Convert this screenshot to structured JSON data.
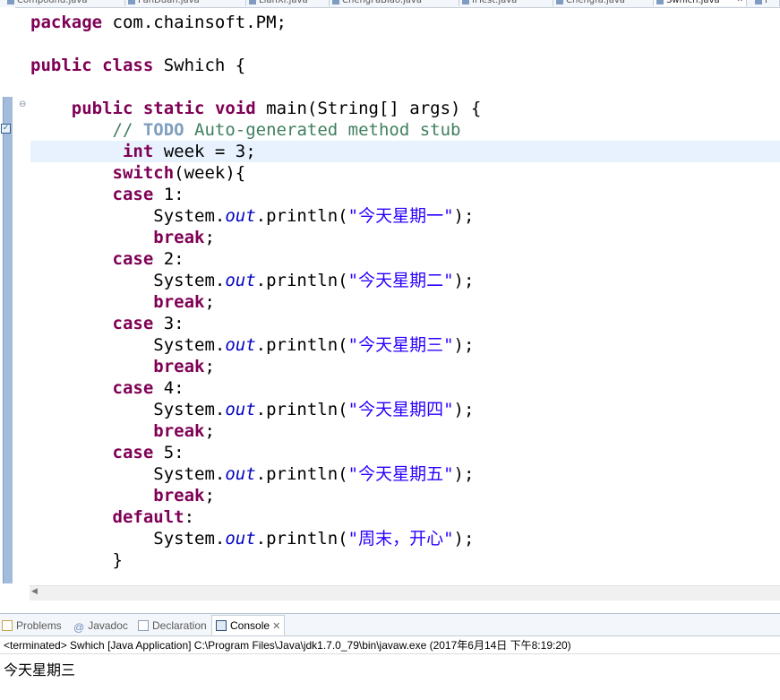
{
  "editor_tabs": [
    "Compound.java",
    "PanDuan.java",
    "LianXi.java",
    "ChengFaBiao.java",
    "IfTest.java",
    "Chengfa.java",
    "Swhich.java",
    "P"
  ],
  "active_tab_index": 6,
  "code": {
    "current_line_index": 6,
    "lines": [
      [
        {
          "t": "package",
          "c": "kw"
        },
        {
          "t": " com.chainsoft.PM;"
        }
      ],
      [],
      [
        {
          "t": "public",
          "c": "kw"
        },
        {
          "t": " "
        },
        {
          "t": "class",
          "c": "kw"
        },
        {
          "t": " Swhich {"
        }
      ],
      [],
      [
        {
          "t": "    "
        },
        {
          "t": "public",
          "c": "kw"
        },
        {
          "t": " "
        },
        {
          "t": "static",
          "c": "kw"
        },
        {
          "t": " "
        },
        {
          "t": "void",
          "c": "kw"
        },
        {
          "t": " main(String[] args) {"
        }
      ],
      [
        {
          "t": "        "
        },
        {
          "t": "// ",
          "c": "cm"
        },
        {
          "t": "TODO",
          "c": "todo"
        },
        {
          "t": " Auto-generated method stub",
          "c": "cm"
        }
      ],
      [
        {
          "t": "         "
        },
        {
          "t": "int",
          "c": "kw"
        },
        {
          "t": " week = 3;"
        }
      ],
      [
        {
          "t": "        "
        },
        {
          "t": "switch",
          "c": "kw"
        },
        {
          "t": "(week){"
        }
      ],
      [
        {
          "t": "        "
        },
        {
          "t": "case",
          "c": "kw"
        },
        {
          "t": " 1:"
        }
      ],
      [
        {
          "t": "            System."
        },
        {
          "t": "out",
          "c": "fld"
        },
        {
          "t": ".println("
        },
        {
          "t": "\"今天星期一\"",
          "c": "str"
        },
        {
          "t": ");"
        }
      ],
      [
        {
          "t": "            "
        },
        {
          "t": "break",
          "c": "kw"
        },
        {
          "t": ";"
        }
      ],
      [
        {
          "t": "        "
        },
        {
          "t": "case",
          "c": "kw"
        },
        {
          "t": " 2:"
        }
      ],
      [
        {
          "t": "            System."
        },
        {
          "t": "out",
          "c": "fld"
        },
        {
          "t": ".println("
        },
        {
          "t": "\"今天星期二\"",
          "c": "str"
        },
        {
          "t": ");"
        }
      ],
      [
        {
          "t": "            "
        },
        {
          "t": "break",
          "c": "kw"
        },
        {
          "t": ";"
        }
      ],
      [
        {
          "t": "        "
        },
        {
          "t": "case",
          "c": "kw"
        },
        {
          "t": " 3:"
        }
      ],
      [
        {
          "t": "            System."
        },
        {
          "t": "out",
          "c": "fld"
        },
        {
          "t": ".println("
        },
        {
          "t": "\"今天星期三\"",
          "c": "str"
        },
        {
          "t": ");"
        }
      ],
      [
        {
          "t": "            "
        },
        {
          "t": "break",
          "c": "kw"
        },
        {
          "t": ";"
        }
      ],
      [
        {
          "t": "        "
        },
        {
          "t": "case",
          "c": "kw"
        },
        {
          "t": " 4:"
        }
      ],
      [
        {
          "t": "            System."
        },
        {
          "t": "out",
          "c": "fld"
        },
        {
          "t": ".println("
        },
        {
          "t": "\"今天星期四\"",
          "c": "str"
        },
        {
          "t": ");"
        }
      ],
      [
        {
          "t": "            "
        },
        {
          "t": "break",
          "c": "kw"
        },
        {
          "t": ";"
        }
      ],
      [
        {
          "t": "        "
        },
        {
          "t": "case",
          "c": "kw"
        },
        {
          "t": " 5:"
        }
      ],
      [
        {
          "t": "            System."
        },
        {
          "t": "out",
          "c": "fld"
        },
        {
          "t": ".println("
        },
        {
          "t": "\"今天星期五\"",
          "c": "str"
        },
        {
          "t": ");"
        }
      ],
      [
        {
          "t": "            "
        },
        {
          "t": "break",
          "c": "kw"
        },
        {
          "t": ";"
        }
      ],
      [
        {
          "t": "        "
        },
        {
          "t": "default",
          "c": "kw"
        },
        {
          "t": ":"
        }
      ],
      [
        {
          "t": "            System."
        },
        {
          "t": "out",
          "c": "fld"
        },
        {
          "t": ".println("
        },
        {
          "t": "\"周末，开心\"",
          "c": "str"
        },
        {
          "t": ");"
        }
      ],
      [
        {
          "t": "        }"
        }
      ]
    ]
  },
  "bottom_panel": {
    "tabs": [
      {
        "label": "Problems",
        "icon": "problems-icon"
      },
      {
        "label": "Javadoc",
        "icon": "at-sign-icon"
      },
      {
        "label": "Declaration",
        "icon": "declaration-icon"
      },
      {
        "label": "Console",
        "icon": "console-icon",
        "active": true
      }
    ],
    "console_header": "<terminated> Swhich [Java Application] C:\\Program Files\\Java\\jdk1.7.0_79\\bin\\javaw.exe (2017年6月14日 下午8:19:20)",
    "console_output": "今天星期三"
  }
}
